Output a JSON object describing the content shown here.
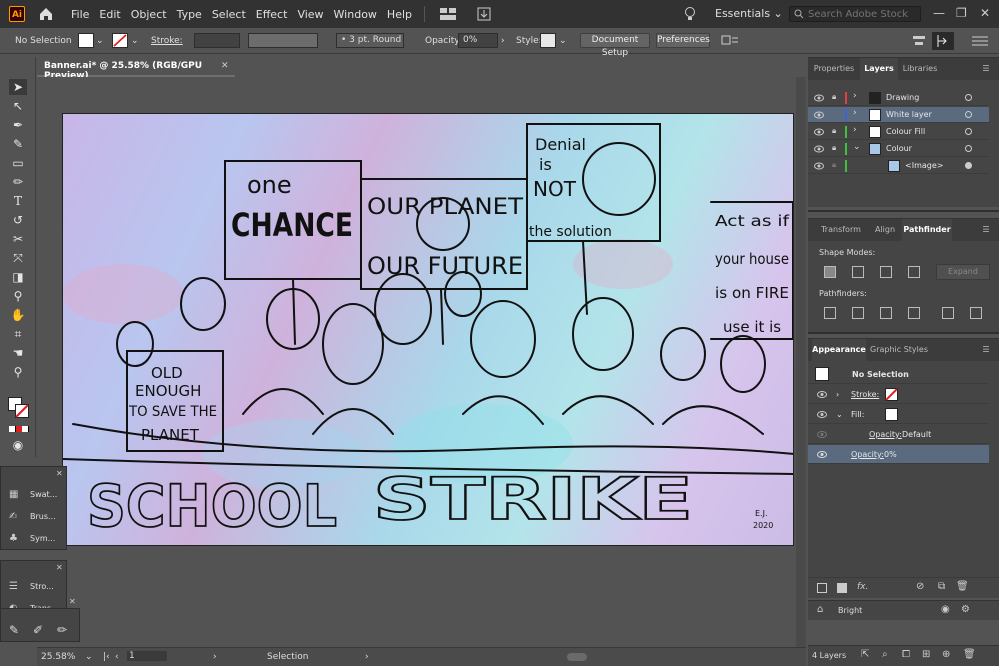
{
  "app": {
    "logo": "Ai"
  },
  "menu": [
    "File",
    "Edit",
    "Object",
    "Type",
    "Select",
    "Effect",
    "View",
    "Window",
    "Help"
  ],
  "workspace": "Essentials",
  "stock_search": {
    "placeholder": "Search Adobe Stock"
  },
  "control_bar": {
    "selection": "No Selection",
    "stroke_label": "Stroke:",
    "brush": "3 pt. Round",
    "opacity_label": "Opacity:",
    "opacity_value": "0%",
    "style_label": "Style:",
    "document_setup": "Document Setup",
    "preferences": "Preferences"
  },
  "document": {
    "tab_title": "Banner.ai* @ 25.58% (RGB/GPU Preview)",
    "zoom": "25.58%",
    "artboard_num": "1",
    "status": "Selection"
  },
  "artwork": {
    "signs": [
      "one",
      "CHANCE",
      "OUR PLANET",
      "OUR FUTURE",
      "Denial",
      "is",
      "NOT",
      "the solution",
      "Act as if",
      "your house",
      "is on FIRE",
      "use it is",
      "OLD",
      "ENOUGH",
      "TO SAVE THE",
      "PLANET",
      "SCHOOL",
      "STRIKE",
      "E.J.",
      "2020"
    ]
  },
  "float_panels": {
    "top": [
      {
        "label": "Swat...",
        "icon": "swatches-icon"
      },
      {
        "label": "Brus...",
        "icon": "brushes-icon"
      },
      {
        "label": "Sym...",
        "icon": "symbols-icon"
      }
    ],
    "bottom": [
      {
        "label": "Stro...",
        "icon": "stroke-icon"
      },
      {
        "label": "Trans...",
        "icon": "transparency-icon"
      }
    ]
  },
  "layers_panel": {
    "tabs": [
      "Properties",
      "Layers",
      "Libraries"
    ],
    "active_tab": "Layers",
    "layers": [
      {
        "name": "Drawing",
        "color": "#e04040"
      },
      {
        "name": "White layer",
        "color": "#4060e0"
      },
      {
        "name": "Colour Fill",
        "color": "#40c040"
      },
      {
        "name": "Colour",
        "color": "#40c040"
      },
      {
        "name": "<Image>",
        "color": "#40c040"
      }
    ],
    "count": "4 Layers"
  },
  "pathfinder_panel": {
    "tabs": [
      "Transform",
      "Align",
      "Pathfinder"
    ],
    "active_tab": "Pathfinder",
    "shape_modes_label": "Shape Modes:",
    "expand_label": "Expand",
    "pathfinders_label": "Pathfinders:"
  },
  "appearance_panel": {
    "tabs": [
      "Appearance",
      "Graphic Styles"
    ],
    "active_tab": "Appearance",
    "title": "No Selection",
    "stroke_label": "Stroke:",
    "fill_label": "Fill:",
    "opacity_label": "Opacity:",
    "opacity_default": "Default",
    "opacity_value": "0%",
    "fx_label": "fx."
  },
  "bottom_bar": {
    "mode": "Bright"
  }
}
